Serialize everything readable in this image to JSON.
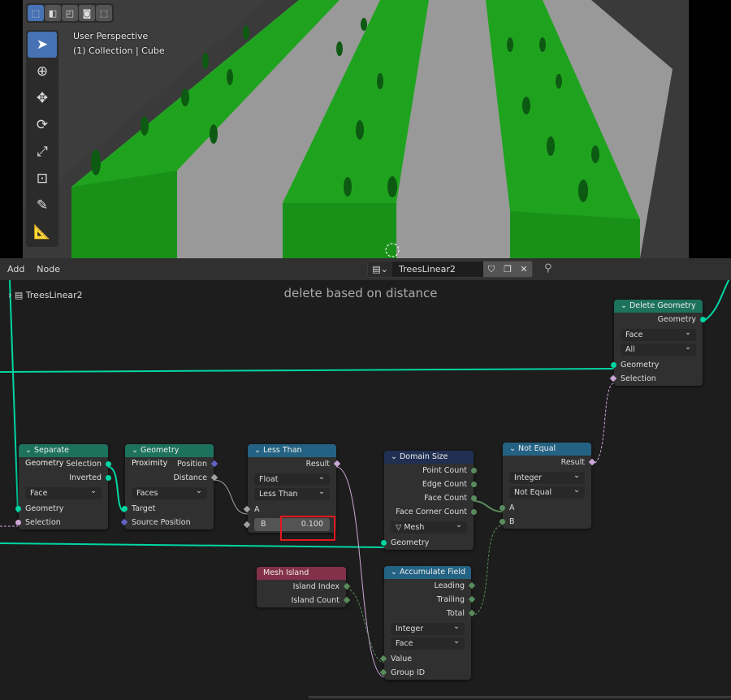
{
  "viewport": {
    "overlay_line1": "User Perspective",
    "overlay_line2": "(1) Collection | Cube",
    "select_modes": [
      "select-new-icon",
      "select-extend-icon",
      "select-subtract-icon",
      "select-invert-icon",
      "select-intersect-icon"
    ],
    "tools": [
      "select-box-icon",
      "cursor-icon",
      "move-icon",
      "rotate-icon",
      "scale-icon",
      "transform-icon",
      "annotate-icon",
      "measure-icon"
    ]
  },
  "node_editor": {
    "menus": [
      "Add",
      "Node"
    ],
    "tree_name": "TreesLinear2",
    "breadcrumb": "TreesLinear2",
    "frame_label": "delete based on distance",
    "nodes": {
      "separate_geometry": {
        "title": "Separate Geometry",
        "outputs": [
          "Selection",
          "Inverted"
        ],
        "domain": "Face",
        "inputs": [
          "Geometry",
          "Selection"
        ]
      },
      "geometry_proximity": {
        "title": "Geometry Proximity",
        "outputs": [
          "Position",
          "Distance"
        ],
        "mode": "Faces",
        "inputs": [
          "Target",
          "Source Position"
        ]
      },
      "less_than": {
        "title": "Less Than",
        "output": "Result",
        "type": "Float",
        "operation": "Less Than",
        "input_a": "A",
        "input_b": "B",
        "b_value": "0.100"
      },
      "domain_size": {
        "title": "Domain Size",
        "outputs": [
          "Point Count",
          "Edge Count",
          "Face Count",
          "Face Corner Count"
        ],
        "component": "Mesh",
        "input": "Geometry"
      },
      "not_equal": {
        "title": "Not Equal",
        "output": "Result",
        "type": "Integer",
        "operation": "Not Equal",
        "inputs": [
          "A",
          "B"
        ]
      },
      "mesh_island": {
        "title": "Mesh Island",
        "outputs": [
          "Island Index",
          "Island Count"
        ]
      },
      "accumulate_field": {
        "title": "Accumulate Field",
        "outputs": [
          "Leading",
          "Trailing",
          "Total"
        ],
        "type": "Integer",
        "domain": "Face",
        "inputs": [
          "Value",
          "Group ID"
        ]
      },
      "delete_geometry": {
        "title": "Delete Geometry",
        "output": "Geometry",
        "domain": "Face",
        "mode": "All",
        "inputs": [
          "Geometry",
          "Selection"
        ]
      }
    }
  },
  "colors": {
    "geometry_header": "#1d725e",
    "math_header": "#246283",
    "input_header": "#83314a",
    "domain_header": "#213052",
    "highlight": "#e0191e",
    "link_geometry": "#00d6a3"
  }
}
